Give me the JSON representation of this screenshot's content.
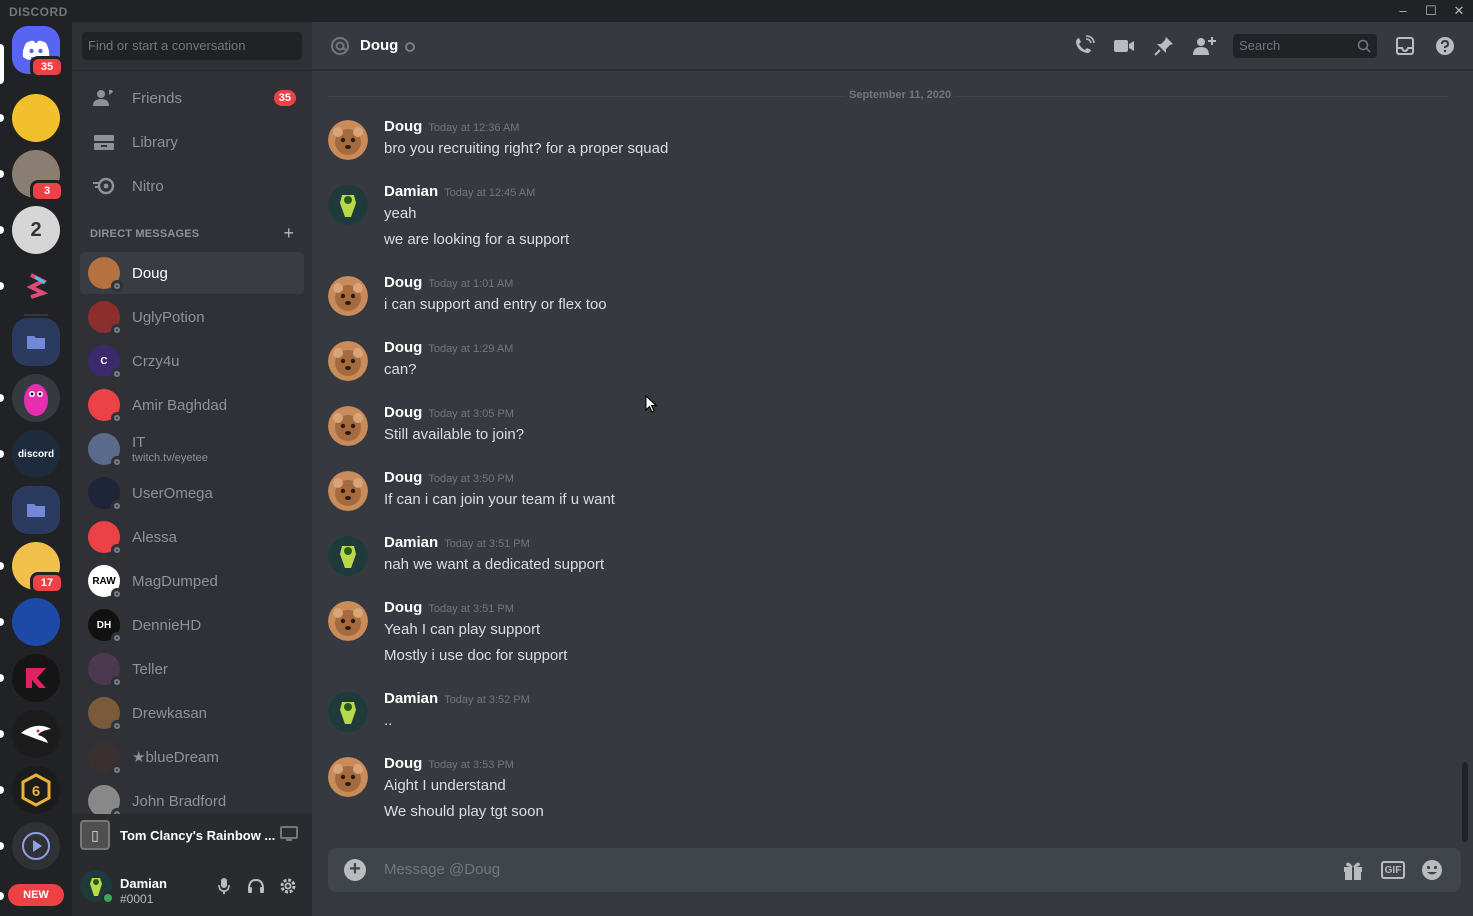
{
  "window": {
    "brand": "DISCORD",
    "controls": {
      "minimize": "–",
      "maximize": "☐",
      "close": "✕"
    }
  },
  "servers": {
    "home_badge": "35",
    "items": [
      {
        "icon": "pirate-sticker-server-icon",
        "color": "#f3c02d",
        "badge": ""
      },
      {
        "icon": "cat-photo-server-icon",
        "color": "#8a7e72",
        "badge": "3"
      },
      {
        "icon": "y2-server-icon",
        "color": "#d6d6d6",
        "badge": ""
      },
      {
        "icon": "s-logo-server-icon",
        "color": "#202225",
        "badge": ""
      },
      {
        "icon": "folder-icon",
        "color": "#2b3a5f",
        "badge": ""
      },
      {
        "icon": "pink-character-server-icon",
        "color": "#36393f",
        "badge": ""
      },
      {
        "icon": "discord-bio-server-icon",
        "color": "#1e2b3c",
        "badge": ""
      },
      {
        "icon": "folder-icon",
        "color": "#2b3a5f",
        "badge": ""
      },
      {
        "icon": "cartoon-face-server-icon",
        "color": "#f0c04a",
        "badge": "17"
      },
      {
        "icon": "devices-server-icon",
        "color": "#1d4aa8",
        "badge": ""
      },
      {
        "icon": "fk-logo-server-icon",
        "color": "#151515",
        "badge": ""
      },
      {
        "icon": "bird-logo-server-icon",
        "color": "#1c1c1c",
        "badge": ""
      },
      {
        "icon": "rainbow-six-server-icon",
        "color": "#1c1c1c",
        "badge": ""
      },
      {
        "icon": "play-server-icon",
        "color": "#2f3136",
        "badge": ""
      }
    ],
    "new_label": "NEW",
    "discord_bio_text": "discord"
  },
  "sidebar": {
    "search_placeholder": "Find or start a conversation",
    "nav": [
      {
        "label": "Friends",
        "badge": "35"
      },
      {
        "label": "Library"
      },
      {
        "label": "Nitro"
      }
    ],
    "dm_header": "DIRECT MESSAGES",
    "dms": [
      {
        "name": "Doug",
        "sub": "",
        "color": "#b5713f",
        "initial": "",
        "active": true
      },
      {
        "name": "UglyPotion",
        "sub": "",
        "color": "#8b2e2e",
        "initial": ""
      },
      {
        "name": "Crzy4u",
        "sub": "",
        "color": "#3b2a6b",
        "initial": "C"
      },
      {
        "name": "Amir Baghdad",
        "sub": "",
        "color": "#ed4245",
        "initial": ""
      },
      {
        "name": "IT",
        "sub": "twitch.tv/eyetee",
        "color": "#5a6a8a",
        "initial": ""
      },
      {
        "name": "UserOmega",
        "sub": "",
        "color": "#1f2538",
        "initial": ""
      },
      {
        "name": "Alessa",
        "sub": "",
        "color": "#ed4245",
        "initial": ""
      },
      {
        "name": "MagDumped",
        "sub": "",
        "color": "#ffffff",
        "initial": "RAW"
      },
      {
        "name": "DennieHD",
        "sub": "",
        "color": "#111111",
        "initial": "DH"
      },
      {
        "name": "Teller",
        "sub": "",
        "color": "#4b3a4f",
        "initial": ""
      },
      {
        "name": "Drewkasan",
        "sub": "",
        "color": "#7a5a3a",
        "initial": ""
      },
      {
        "name": "★blueDream",
        "sub": "",
        "color": "#3a3030",
        "initial": ""
      },
      {
        "name": "John Bradford",
        "sub": "",
        "color": "#888888",
        "initial": ""
      }
    ],
    "activity": {
      "game": "Tom Clancy's Rainbow ..."
    },
    "user": {
      "name": "Damian",
      "tag": "#0001"
    }
  },
  "chat": {
    "title": "Doug",
    "search_placeholder": "Search",
    "date_separator": "September 11, 2020",
    "messages": [
      {
        "author": "Doug",
        "time": "Today at 12:36 AM",
        "lines": [
          "bro you recruiting right? for a proper squad"
        ]
      },
      {
        "author": "Damian",
        "time": "Today at 12:45 AM",
        "lines": [
          "yeah",
          "we are looking for a support"
        ]
      },
      {
        "author": "Doug",
        "time": "Today at 1:01 AM",
        "lines": [
          "i can support and entry or flex too"
        ]
      },
      {
        "author": "Doug",
        "time": "Today at 1:29 AM",
        "lines": [
          "can?"
        ]
      },
      {
        "author": "Doug",
        "time": "Today at 3:05 PM",
        "lines": [
          "Still available to join?"
        ]
      },
      {
        "author": "Doug",
        "time": "Today at 3:50 PM",
        "lines": [
          "If can i can join your team if u want"
        ]
      },
      {
        "author": "Damian",
        "time": "Today at 3:51 PM",
        "lines": [
          "nah we want a dedicated support"
        ]
      },
      {
        "author": "Doug",
        "time": "Today at 3:51 PM",
        "lines": [
          "Yeah I can play support",
          "Mostly i use doc for support"
        ]
      },
      {
        "author": "Damian",
        "time": "Today at 3:52 PM",
        "lines": [
          ".."
        ]
      },
      {
        "author": "Doug",
        "time": "Today at 3:53 PM",
        "lines": [
          "Aight I understand",
          "We should play tgt soon"
        ]
      }
    ],
    "composer_placeholder": "Message @Doug",
    "gif_label": "GIF"
  },
  "colors": {
    "accent": "#5865f2",
    "danger": "#ed4245",
    "online": "#3ba55d",
    "doug_avatar": "#c98b5a",
    "damian_avatar": "#1f3a3a"
  }
}
